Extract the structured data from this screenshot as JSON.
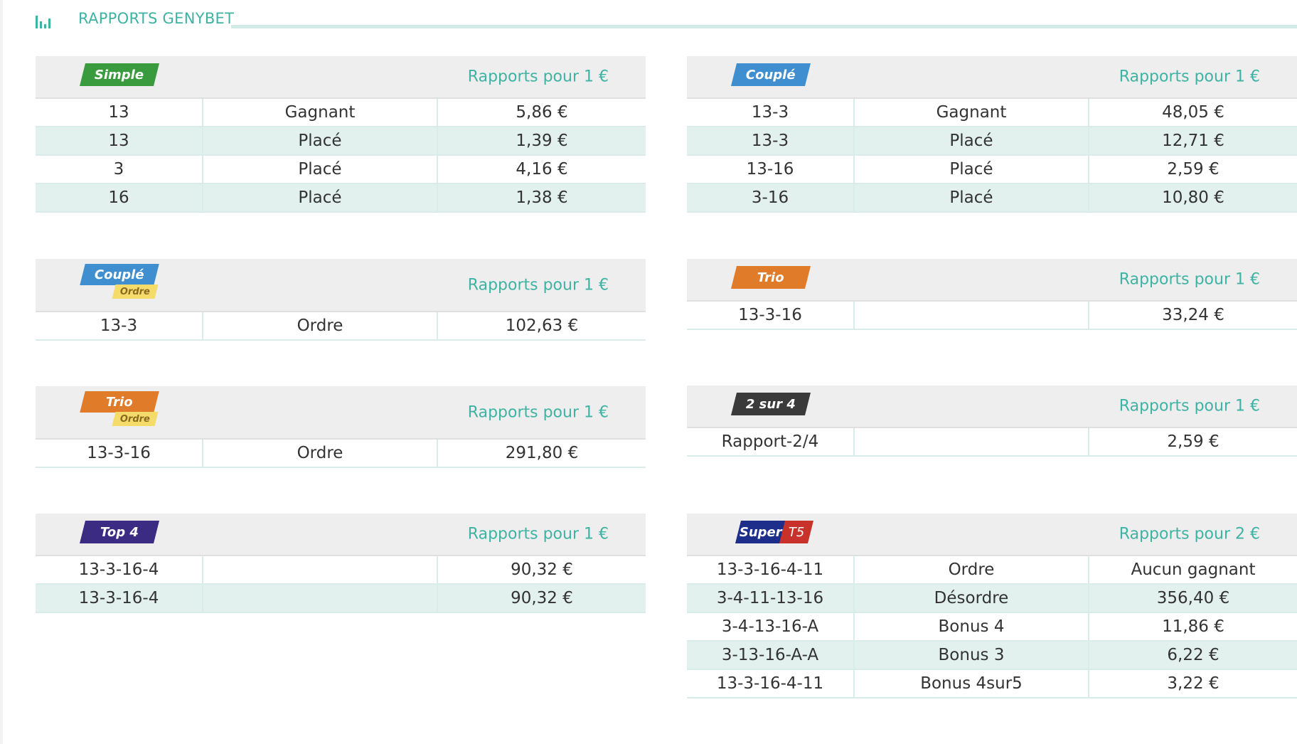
{
  "header": {
    "title": "RAPPORTS GENYBET"
  },
  "colors": {
    "accent": "#3eb3a4",
    "simple": "#3a9b3e",
    "couple": "#3f8fd0",
    "trio": "#e07b2a",
    "ordre": "#f5dc6a",
    "deux_sur_4": "#3a3a3a",
    "top4": "#3b2b83",
    "super_blue": "#1d2f8a",
    "super_red": "#c8322a"
  },
  "blocks": {
    "simple": {
      "badge": "Simple",
      "rapports": "Rapports pour 1 €",
      "rows": [
        [
          "13",
          "Gagnant",
          "5,86 €"
        ],
        [
          "13",
          "Placé",
          "1,39 €"
        ],
        [
          "3",
          "Placé",
          "4,16 €"
        ],
        [
          "16",
          "Placé",
          "1,38 €"
        ]
      ]
    },
    "couple": {
      "badge": "Couplé",
      "rapports": "Rapports pour 1 €",
      "rows": [
        [
          "13-3",
          "Gagnant",
          "48,05 €"
        ],
        [
          "13-3",
          "Placé",
          "12,71 €"
        ],
        [
          "13-16",
          "Placé",
          "2,59 €"
        ],
        [
          "3-16",
          "Placé",
          "10,80 €"
        ]
      ]
    },
    "couple_ordre": {
      "badge": "Couplé",
      "badge_sub": "Ordre",
      "rapports": "Rapports pour 1 €",
      "rows": [
        [
          "13-3",
          "Ordre",
          "102,63 €"
        ]
      ]
    },
    "trio": {
      "badge": "Trio",
      "rapports": "Rapports pour 1 €",
      "rows": [
        [
          "13-3-16",
          "",
          "33,24 €"
        ]
      ]
    },
    "trio_ordre": {
      "badge": "Trio",
      "badge_sub": "Ordre",
      "rapports": "Rapports pour 1 €",
      "rows": [
        [
          "13-3-16",
          "Ordre",
          "291,80 €"
        ]
      ]
    },
    "deux_sur_4": {
      "badge": "2 sur 4",
      "rapports": "Rapports pour 1 €",
      "rows": [
        [
          "Rapport-2/4",
          "",
          "2,59 €"
        ]
      ]
    },
    "top4": {
      "badge": "Top 4",
      "rapports": "Rapports pour 1 €",
      "rows": [
        [
          "13-3-16-4",
          "",
          "90,32 €"
        ],
        [
          "13-3-16-4",
          "",
          "90,32 €"
        ]
      ]
    },
    "super_t5": {
      "badge": "Super",
      "badge_sub": "T5",
      "rapports": "Rapports pour 2 €",
      "rows": [
        [
          "13-3-16-4-11",
          "Ordre",
          "Aucun gagnant"
        ],
        [
          "3-4-11-13-16",
          "Désordre",
          "356,40 €"
        ],
        [
          "3-4-13-16-A",
          "Bonus 4",
          "11,86 €"
        ],
        [
          "3-13-16-A-A",
          "Bonus 3",
          "6,22 €"
        ],
        [
          "13-3-16-4-11",
          "Bonus 4sur5",
          "3,22 €"
        ]
      ]
    }
  }
}
